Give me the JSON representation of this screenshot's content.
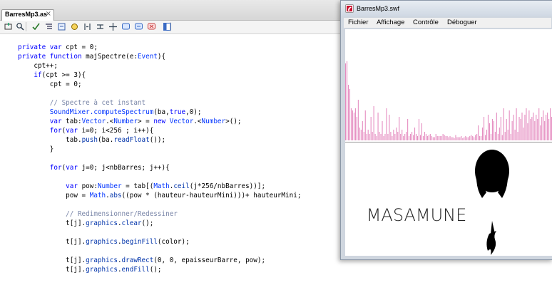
{
  "editor": {
    "tab": {
      "label": "BarresMp3.as",
      "close": "×"
    },
    "toolbar": {
      "icons": [
        "insert-target-icon",
        "find-icon",
        "check-syntax-icon",
        "auto-format-icon",
        "code-hint-icon",
        "debug-options-icon",
        "collapse-between-braces-icon",
        "collapse-selection-icon",
        "expand-all-icon",
        "apply-block-comment-icon",
        "apply-line-comment-icon",
        "remove-comment-icon",
        "show-hide-toolbox-icon"
      ]
    },
    "code_lines": [
      [
        [
          "kw",
          "private var "
        ],
        [
          "",
          "cpt = 0;"
        ]
      ],
      [
        [
          "kw",
          "private function "
        ],
        [
          "",
          "majSpectre(e:"
        ],
        [
          "ty",
          "Event"
        ],
        [
          "",
          "){"
        ]
      ],
      [
        [
          "",
          "    cpt++;"
        ]
      ],
      [
        [
          "",
          "    "
        ],
        [
          "kw",
          "if"
        ],
        [
          "",
          "(cpt >= 3){"
        ]
      ],
      [
        [
          "",
          "        cpt = 0;"
        ]
      ],
      [
        [
          "",
          ""
        ]
      ],
      [
        [
          "cm",
          "        // Spectre à cet instant"
        ]
      ],
      [
        [
          "",
          "        "
        ],
        [
          "ty",
          "SoundMixer.computeSpectrum"
        ],
        [
          "",
          "(ba,"
        ],
        [
          "kw",
          "true"
        ],
        [
          "",
          ",0);"
        ]
      ],
      [
        [
          "",
          "        "
        ],
        [
          "kw",
          "var "
        ],
        [
          "",
          "tab:"
        ],
        [
          "ty",
          "Vector"
        ],
        [
          "",
          ".<"
        ],
        [
          "ty",
          "Number"
        ],
        [
          "",
          "> = "
        ],
        [
          "kw",
          "new "
        ],
        [
          "ty",
          "Vector"
        ],
        [
          "",
          ".<"
        ],
        [
          "ty",
          "Number"
        ],
        [
          "",
          ">();"
        ]
      ],
      [
        [
          "",
          "        "
        ],
        [
          "kw",
          "for"
        ],
        [
          "",
          "("
        ],
        [
          "kw",
          "var "
        ],
        [
          "",
          "i=0; i<256 ; i++){"
        ]
      ],
      [
        [
          "",
          "            tab."
        ],
        [
          "ap",
          "push"
        ],
        [
          "",
          "(ba."
        ],
        [
          "ap",
          "readFloat"
        ],
        [
          "",
          "());"
        ]
      ],
      [
        [
          "",
          "        }"
        ]
      ],
      [
        [
          "",
          ""
        ]
      ],
      [
        [
          "",
          "        "
        ],
        [
          "kw",
          "for"
        ],
        [
          "",
          "("
        ],
        [
          "kw",
          "var "
        ],
        [
          "",
          "j=0; j<nbBarres; j++){"
        ]
      ],
      [
        [
          "",
          ""
        ]
      ],
      [
        [
          "",
          "            "
        ],
        [
          "kw",
          "var "
        ],
        [
          "",
          "pow:"
        ],
        [
          "ty",
          "Number"
        ],
        [
          "",
          " = tab[("
        ],
        [
          "ty",
          "Math"
        ],
        [
          "",
          "."
        ],
        [
          "ap",
          "ceil"
        ],
        [
          "",
          "(j*256/nbBarres))];"
        ]
      ],
      [
        [
          "",
          "            pow = "
        ],
        [
          "ty",
          "Math"
        ],
        [
          "",
          "."
        ],
        [
          "ap",
          "abs"
        ],
        [
          "",
          "((pow * (hauteur-hauteurMini)))+ hauteurMini;"
        ]
      ],
      [
        [
          "",
          ""
        ]
      ],
      [
        [
          "cm",
          "            // Redimensionner/Redessiner"
        ]
      ],
      [
        [
          "",
          "            t[j]."
        ],
        [
          "ap",
          "graphics"
        ],
        [
          "",
          "."
        ],
        [
          "ap",
          "clear"
        ],
        [
          "",
          "();"
        ]
      ],
      [
        [
          "",
          ""
        ]
      ],
      [
        [
          "",
          "            t[j]."
        ],
        [
          "ap",
          "graphics"
        ],
        [
          "",
          "."
        ],
        [
          "ap",
          "beginFill"
        ],
        [
          "",
          "(color);"
        ]
      ],
      [
        [
          "",
          ""
        ]
      ],
      [
        [
          "",
          "            t[j]."
        ],
        [
          "ap",
          "graphics"
        ],
        [
          "",
          "."
        ],
        [
          "ap",
          "drawRect"
        ],
        [
          "",
          "(0, 0, epaisseurBarre, pow);"
        ]
      ],
      [
        [
          "",
          "            t[j]."
        ],
        [
          "ap",
          "graphics"
        ],
        [
          "",
          "."
        ],
        [
          "ap",
          "endFill"
        ],
        [
          "",
          "();"
        ]
      ]
    ]
  },
  "swf_window": {
    "title": "BarresMp3.swf",
    "menu": [
      "Fichier",
      "Affichage",
      "Contrôle",
      "Déboguer"
    ],
    "logo_text": "MASAMUNE",
    "bar_color": "#e58cc0",
    "spectrum": [
      0.72,
      0.74,
      0.52,
      0.48,
      0.3,
      0.28,
      0.26,
      0.3,
      0.22,
      0.38,
      0.12,
      0.1,
      0.18,
      0.08,
      0.28,
      0.06,
      0.1,
      0.06,
      0.22,
      0.08,
      0.32,
      0.06,
      0.04,
      0.26,
      0.08,
      0.06,
      0.18,
      0.04,
      0.06,
      0.3,
      0.06,
      0.24,
      0.08,
      0.04,
      0.1,
      0.06,
      0.12,
      0.08,
      0.22,
      0.06,
      0.1,
      0.04,
      0.06,
      0.08,
      0.2,
      0.04,
      0.06,
      0.08,
      0.05,
      0.12,
      0.06,
      0.04,
      0.2,
      0.05,
      0.16,
      0.04,
      0.08,
      0.06,
      0.04,
      0.05,
      0.06,
      0.04,
      0.03,
      0.03,
      0.06,
      0.04,
      0.04,
      0.04,
      0.04,
      0.06,
      0.05,
      0.04,
      0.04,
      0.03,
      0.04,
      0.03,
      0.03,
      0.02,
      0.05,
      0.03,
      0.03,
      0.03,
      0.04,
      0.02,
      0.03,
      0.04,
      0.03,
      0.03,
      0.04,
      0.05,
      0.04,
      0.03,
      0.05,
      0.06,
      0.14,
      0.04,
      0.04,
      0.12,
      0.22,
      0.05,
      0.1,
      0.24,
      0.16,
      0.06,
      0.2,
      0.18,
      0.08,
      0.26,
      0.06,
      0.12,
      0.22,
      0.05,
      0.3,
      0.08,
      0.2,
      0.1,
      0.28,
      0.06,
      0.18,
      0.24,
      0.1,
      0.3,
      0.08,
      0.22,
      0.2,
      0.26,
      0.12,
      0.24,
      0.3,
      0.16,
      0.28,
      0.2,
      0.22,
      0.26,
      0.18,
      0.24,
      0.2,
      0.3,
      0.14,
      0.22,
      0.28,
      0.18,
      0.24,
      0.26,
      0.2,
      0.3,
      0.22
    ]
  }
}
